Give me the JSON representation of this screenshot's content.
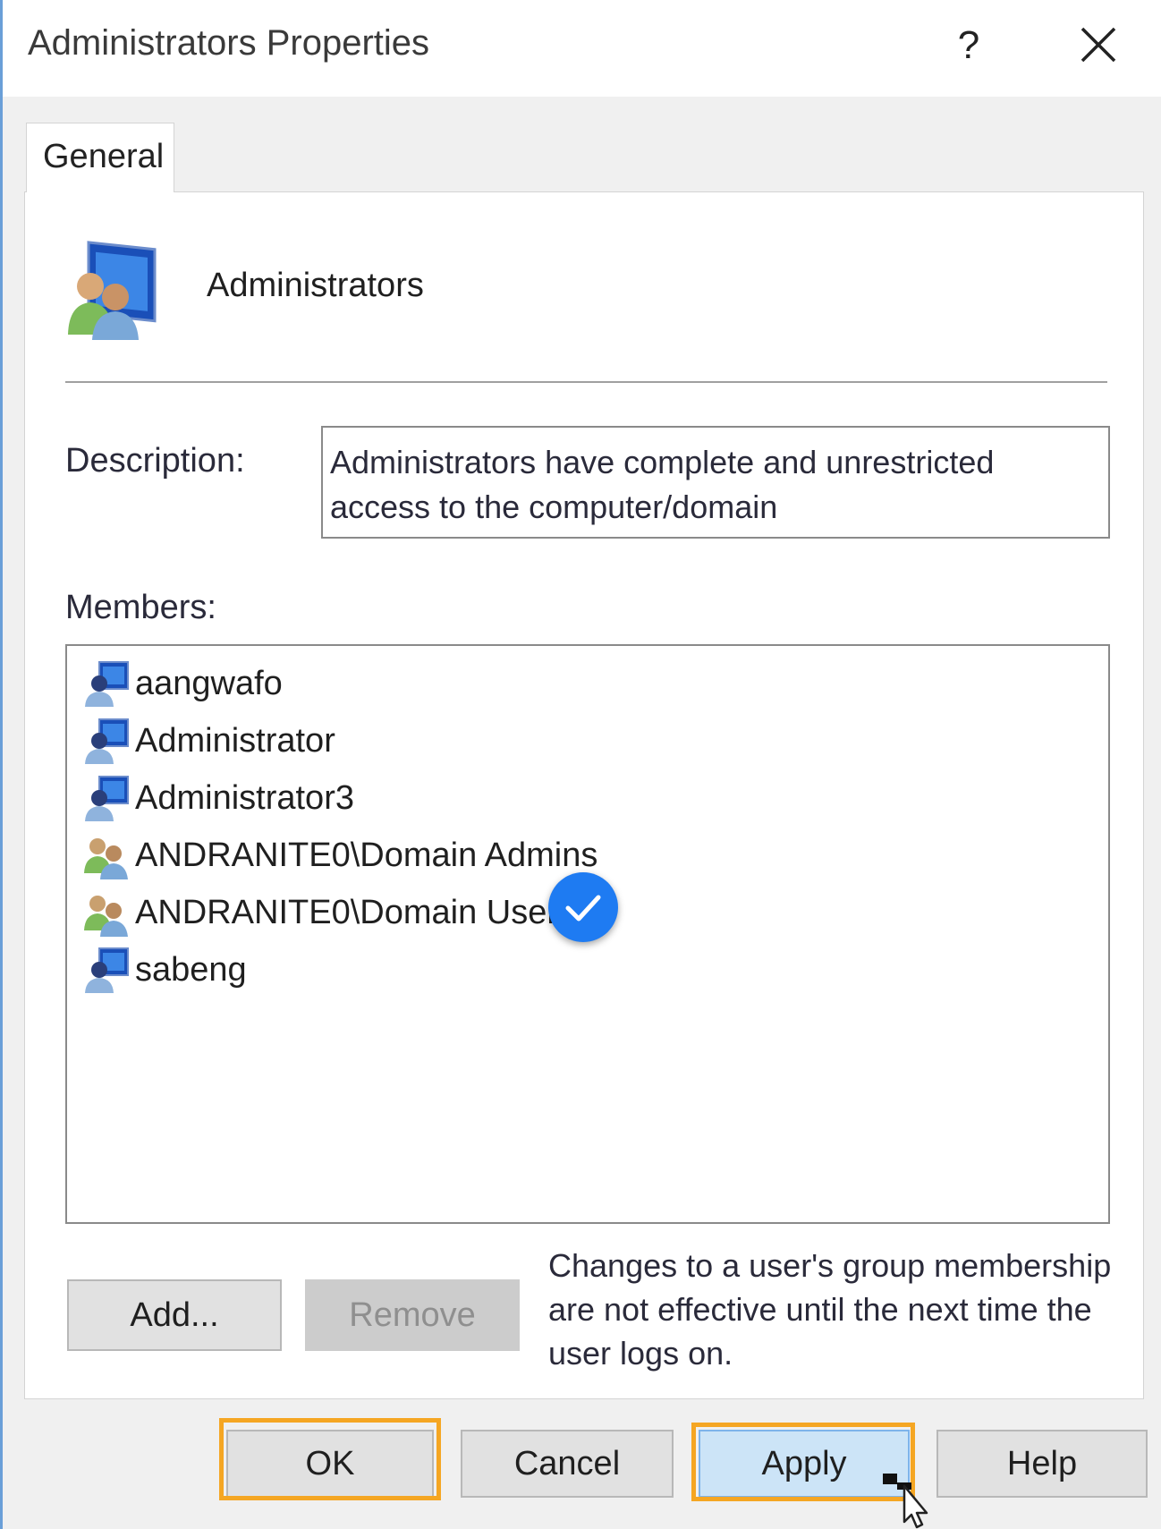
{
  "window": {
    "title": "Administrators Properties",
    "help_glyph": "?",
    "close_icon": "close-icon"
  },
  "tabs": [
    {
      "label": "General",
      "active": true
    }
  ],
  "group": {
    "icon": "user-group-icon",
    "name": "Administrators"
  },
  "description": {
    "label": "Description:",
    "value": "Administrators have complete and unrestricted access to the computer/domain"
  },
  "members": {
    "label": "Members:",
    "items": [
      {
        "name": "aangwafo",
        "icon": "user-icon"
      },
      {
        "name": "Administrator",
        "icon": "user-icon"
      },
      {
        "name": "Administrator3",
        "icon": "user-icon"
      },
      {
        "name": "ANDRANITE0\\Domain Admins",
        "icon": "group-icon"
      },
      {
        "name": "ANDRANITE0\\Domain Users",
        "icon": "group-icon"
      },
      {
        "name": "sabeng",
        "icon": "user-icon"
      }
    ]
  },
  "actions": {
    "add_label": "Add...",
    "remove_label": "Remove"
  },
  "note": "Changes to a user's group membership are not effective until the next time the user logs on.",
  "footer": {
    "ok_label": "OK",
    "cancel_label": "Cancel",
    "apply_label": "Apply",
    "help_label": "Help"
  },
  "colors": {
    "highlight": "#f5a623",
    "checkmark_badge": "#1e7bf2",
    "apply_bg": "#cce4f7"
  }
}
